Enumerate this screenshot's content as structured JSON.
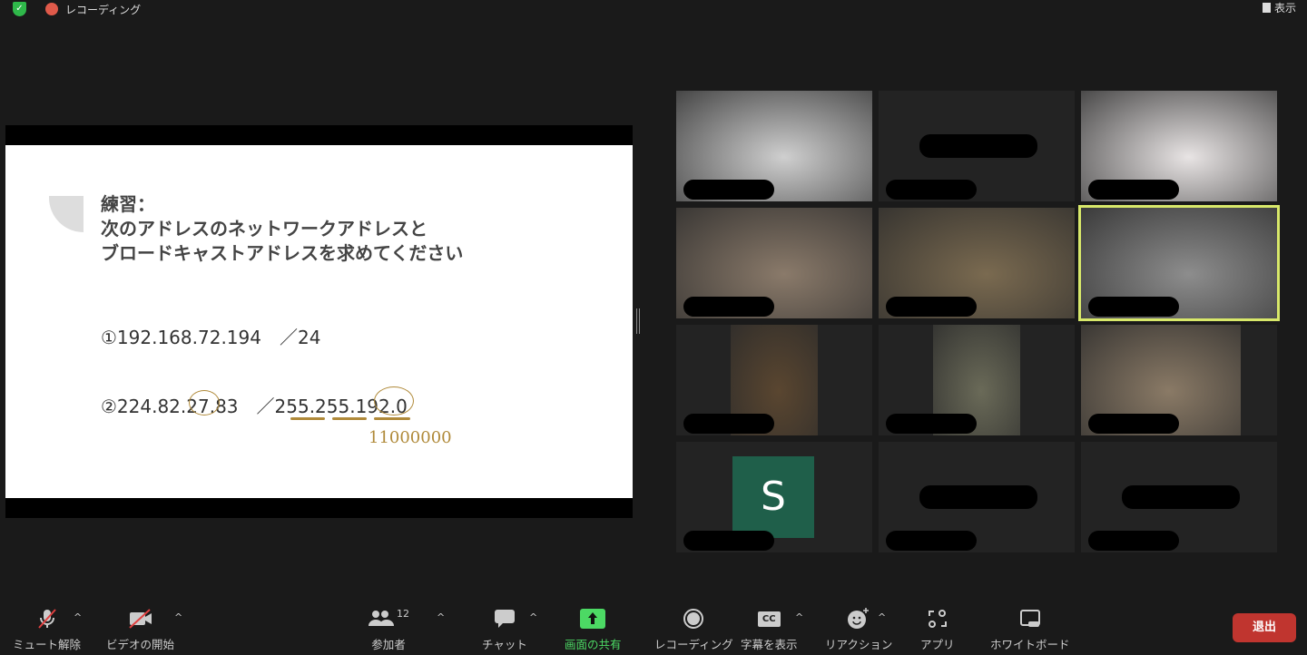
{
  "topbar": {
    "recording_label": "レコーディング",
    "view_label": "表示"
  },
  "slide": {
    "title_line1": "練習：",
    "title_line2": "次のアドレスのネットワークアドレスと",
    "title_line3": "ブロードキャストアドレスを求めてください",
    "q1": "①192.168.72.194　／24",
    "q2": "②224.82.27.83　／255.255.192.0",
    "handwriting": "11000000"
  },
  "tiles": [
    {
      "type": "video",
      "bg": "#cfcfcf"
    },
    {
      "type": "name"
    },
    {
      "type": "video",
      "bg": "#e8e4e4"
    },
    {
      "type": "video",
      "bg": "#8a7a6a"
    },
    {
      "type": "video",
      "bg": "#7a6a50"
    },
    {
      "type": "video",
      "bg": "#8d8d8d",
      "active": true
    },
    {
      "type": "video",
      "bg": "#5a4630"
    },
    {
      "type": "video",
      "bg": "#6a6a58"
    },
    {
      "type": "video",
      "bg": "#8a7a66"
    },
    {
      "type": "avatar",
      "initial": "S"
    },
    {
      "type": "name"
    },
    {
      "type": "name"
    }
  ],
  "toolbar": {
    "unmute": "ミュート解除",
    "start_video": "ビデオの開始",
    "participants": "参加者",
    "participant_count": "12",
    "chat": "チャット",
    "share": "画面の共有",
    "record": "レコーディング",
    "captions": "字幕を表示",
    "cc": "CC",
    "reactions": "リアクション",
    "apps": "アプリ",
    "whiteboard": "ホワイトボード",
    "leave": "退出"
  },
  "colors": {
    "share": "#4cd964",
    "leave": "#c0352f",
    "active_speaker": "#d8e86a"
  }
}
